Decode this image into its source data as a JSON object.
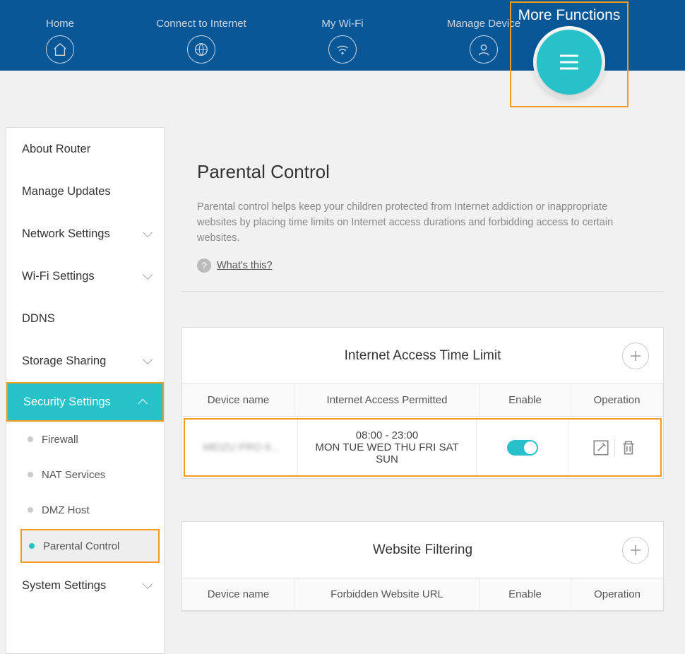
{
  "nav": {
    "home": "Home",
    "connect": "Connect to Internet",
    "wifi": "My Wi-Fi",
    "manage": "Manage Device",
    "more": "More Functions"
  },
  "sidebar": {
    "about": "About Router",
    "updates": "Manage Updates",
    "network": "Network Settings",
    "wifi": "Wi-Fi Settings",
    "ddns": "DDNS",
    "storage": "Storage Sharing",
    "security": "Security Settings",
    "security_sub": {
      "firewall": "Firewall",
      "nat": "NAT Services",
      "dmz": "DMZ Host",
      "parental": "Parental Control"
    },
    "system": "System Settings"
  },
  "main": {
    "title": "Parental Control",
    "desc": "Parental control helps keep your children protected from Internet addiction or inappropriate websites by placing time limits on Internet access durations and forbidding access to certain websites.",
    "whats_this": "What's this?"
  },
  "time_panel": {
    "title": "Internet Access Time Limit",
    "cols": {
      "device": "Device name",
      "permitted": "Internet Access Permitted",
      "enable": "Enable",
      "op": "Operation"
    },
    "rows": [
      {
        "device": "MEIZU PRO 6...",
        "time": "08:00 - 23:00",
        "days": "MON TUE WED THU FRI SAT SUN",
        "enabled": true
      }
    ]
  },
  "filter_panel": {
    "title": "Website Filtering",
    "cols": {
      "device": "Device name",
      "url": "Forbidden Website URL",
      "enable": "Enable",
      "op": "Operation"
    }
  }
}
